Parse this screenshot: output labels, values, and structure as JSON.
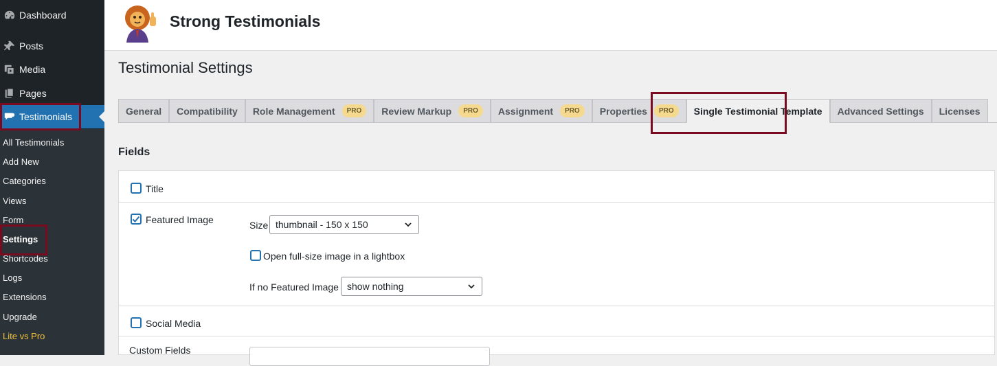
{
  "sidebar": {
    "top_items": [
      {
        "label": "Dashboard",
        "icon": "dashboard-icon"
      },
      {
        "label": "Posts",
        "icon": "pin-icon"
      },
      {
        "label": "Media",
        "icon": "media-icon"
      },
      {
        "label": "Pages",
        "icon": "pages-icon"
      },
      {
        "label": "Testimonials",
        "icon": "testimonials-icon"
      }
    ],
    "sub_items": [
      "All Testimonials",
      "Add New",
      "Categories",
      "Views",
      "Form",
      "Settings",
      "Shortcodes",
      "Logs",
      "Extensions",
      "Upgrade",
      "Lite vs Pro"
    ]
  },
  "header": {
    "brand": "Strong Testimonials",
    "logo_icon": "lion-mascot-logo"
  },
  "page": {
    "title": "Testimonial Settings"
  },
  "tabs": [
    {
      "label": "General",
      "pro": ""
    },
    {
      "label": "Compatibility",
      "pro": ""
    },
    {
      "label": "Role Management",
      "pro": "PRO"
    },
    {
      "label": "Review Markup",
      "pro": "PRO"
    },
    {
      "label": "Assignment",
      "pro": "PRO"
    },
    {
      "label": "Properties",
      "pro": "PRO"
    },
    {
      "label": "Single Testimonial Template",
      "pro": ""
    },
    {
      "label": "Advanced Settings",
      "pro": ""
    },
    {
      "label": "Licenses",
      "pro": ""
    }
  ],
  "fields": {
    "section_title": "Fields",
    "title_label": "Title",
    "title_checked": false,
    "featured_label": "Featured Image",
    "featured_checked": true,
    "size_label": "Size",
    "size_value": "thumbnail - 150 x 150",
    "lightbox_label": "Open full-size image in a lightbox",
    "lightbox_checked": false,
    "no_image_label": "If no Featured Image",
    "no_image_value": "show nothing",
    "social_label": "Social Media",
    "social_checked": false,
    "custom_label": "Custom Fields"
  },
  "colors": {
    "sidebar_bg": "#1d2327",
    "submenu_bg": "#2c3338",
    "active_blue": "#2271b1",
    "highlight_red": "#7a0a1f",
    "pro_badge": "#f5d98e",
    "gold_link": "#f0c33c"
  }
}
